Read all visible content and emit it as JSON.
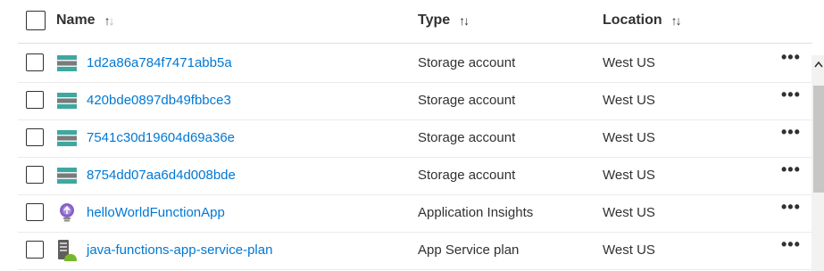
{
  "columns": {
    "name": "Name",
    "type": "Type",
    "location": "Location",
    "name_sort_glyph": "↑↓",
    "type_sort_glyph": "↑↓",
    "location_sort_glyph": "↑↓"
  },
  "rows": [
    {
      "name": "1d2a86a784f7471abb5a",
      "type": "Storage account",
      "location": "West US",
      "icon": "storage-account-icon",
      "more": "•••"
    },
    {
      "name": "420bde0897db49fbbce3",
      "type": "Storage account",
      "location": "West US",
      "icon": "storage-account-icon",
      "more": "•••"
    },
    {
      "name": "7541c30d19604d69a36e",
      "type": "Storage account",
      "location": "West US",
      "icon": "storage-account-icon",
      "more": "•••"
    },
    {
      "name": "8754dd07aa6d4d008bde",
      "type": "Storage account",
      "location": "West US",
      "icon": "storage-account-icon",
      "more": "•••"
    },
    {
      "name": "helloWorldFunctionApp",
      "type": "Application Insights",
      "location": "West US",
      "icon": "application-insights-icon",
      "more": "•••"
    },
    {
      "name": "java-functions-app-service-plan",
      "type": "App Service plan",
      "location": "West US",
      "icon": "app-service-plan-icon",
      "more": "•••"
    }
  ],
  "colors": {
    "link": "#0078d4",
    "text": "#323130",
    "border": "#e1dfdd",
    "storage_teal": "#3ea8a0",
    "insights_purple": "#8661c5"
  }
}
